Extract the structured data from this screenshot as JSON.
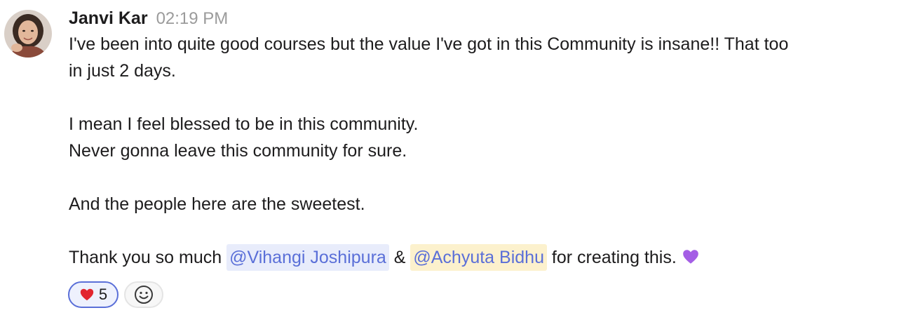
{
  "message": {
    "author": "Janvi Kar",
    "timestamp": "02:19 PM",
    "paragraphs": {
      "p1": "I've been into quite good courses but the value I've got in this Community is insane!! That too",
      "p1b": "in just 2 days.",
      "p2": "I mean I feel blessed to be in this community.",
      "p3": "Never gonna leave this community for sure.",
      "p4": "And the people here are the sweetest.",
      "p5_start": "Thank you so much ",
      "p5_and": " & ",
      "p5_end": " for creating this. "
    },
    "mentions": [
      "@Vihangi Joshipura",
      "@Achyuta Bidhu"
    ],
    "trailing_emoji": "purple-heart-icon"
  },
  "reactions": [
    {
      "emoji": "red-heart-icon",
      "count": "5",
      "selected": true
    },
    {
      "emoji": "add-reaction-icon",
      "count": ""
    }
  ],
  "colors": {
    "mention_text": "#5a6fd8",
    "mention_bg_1": "#e8ecfb",
    "mention_bg_2": "#fcf1cd",
    "timestamp": "#9b9b9b",
    "reaction_selected_border": "#5a6fd8"
  }
}
